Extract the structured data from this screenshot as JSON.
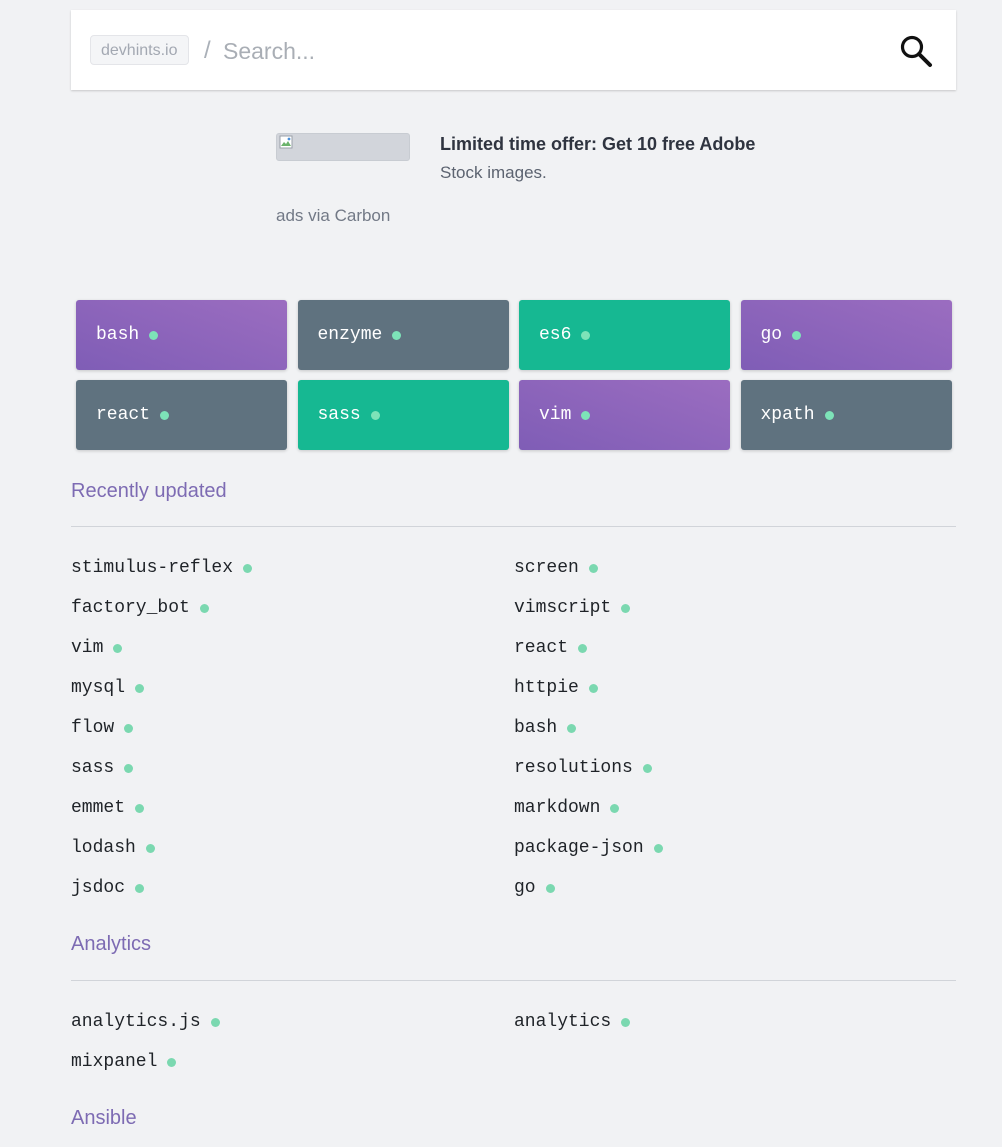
{
  "header": {
    "brand": "devhints.io",
    "separator": "/",
    "search_placeholder": "Search..."
  },
  "ad": {
    "title": "Limited time offer: Get 10 free Adobe",
    "subtitle": "Stock images.",
    "via": "ads via Carbon"
  },
  "featured": [
    {
      "label": "bash",
      "color": "purple"
    },
    {
      "label": "enzyme",
      "color": "slate"
    },
    {
      "label": "es6",
      "color": "green"
    },
    {
      "label": "go",
      "color": "purple"
    },
    {
      "label": "react",
      "color": "slate"
    },
    {
      "label": "sass",
      "color": "green"
    },
    {
      "label": "vim",
      "color": "purple"
    },
    {
      "label": "xpath",
      "color": "slate"
    }
  ],
  "sections": {
    "recent": {
      "title": "Recently updated",
      "items": [
        "stimulus-reflex",
        "screen",
        "factory_bot",
        "vimscript",
        "vim",
        "react",
        "mysql",
        "httpie",
        "flow",
        "bash",
        "sass",
        "resolutions",
        "emmet",
        "markdown",
        "lodash",
        "package-json",
        "jsdoc",
        "go"
      ]
    },
    "analytics": {
      "title": "Analytics",
      "items": [
        "analytics.js",
        "analytics",
        "mixpanel"
      ]
    },
    "ansible": {
      "title": "Ansible"
    }
  },
  "colors": {
    "purple": "#8a63bb",
    "slate": "#5f727f",
    "green": "#16b892",
    "dot": "#7bd8b0",
    "section_title": "#7d6bb3"
  },
  "icons": {
    "search": "search-icon",
    "broken_image": "broken-image-icon",
    "dot": "dot-icon"
  }
}
